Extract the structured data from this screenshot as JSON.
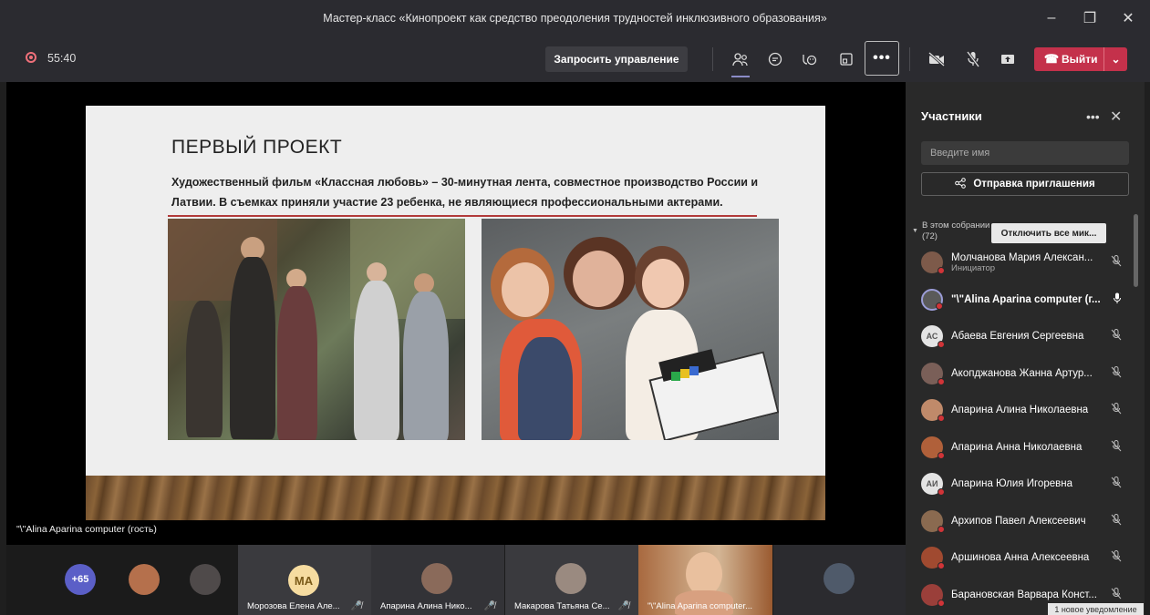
{
  "window": {
    "title": "Мастер-класс «Кинопроект как средство преодоления трудностей инклюзивного образования»",
    "controls": {
      "minimize": "–",
      "maximize": "❐",
      "close": "✕"
    }
  },
  "toolbar": {
    "timer": "55:40",
    "request_control_label": "Запросить управление",
    "more_label": "•••",
    "leave_label": "Выйти",
    "icons": [
      "participants-icon",
      "chat-icon",
      "reactions-icon",
      "rooms-icon",
      "camera-off-icon",
      "mic-off-icon",
      "share-icon"
    ]
  },
  "slide": {
    "title": "ПЕРВЫЙ ПРОЕКТ",
    "text": "Художественный фильм «Классная любовь» – 30-минутная лента, совместное производство России и Латвии. В съемках приняли участие 23 ребенка, не являющиеся профессиональными актерами."
  },
  "stage": {
    "presenter_label": "\"\\\"Alina Aparina computer (гость)"
  },
  "panel": {
    "title": "Участники",
    "more": "•••",
    "close": "✕",
    "search_placeholder": "Введите имя",
    "invite_label": "Отправка приглашения",
    "group_label_line1": "В этом собрании",
    "group_label_line2": "(72)",
    "mute_all_label": "Отключить все мик...",
    "participants": [
      {
        "name": "Молчанова Мария Алексан...",
        "role": "Инициатор",
        "initials": "",
        "color": "#7d5a4a",
        "mic": "mic-off"
      },
      {
        "name": "\"\\\"Alina Aparina computer (г...",
        "role": "",
        "initials": "",
        "color": "#5a5a5a",
        "mic": "mic-on"
      },
      {
        "name": "Абаева Евгения Сергеевна",
        "role": "",
        "initials": "АС",
        "color": "#e4e4e4",
        "mic": "mic-off"
      },
      {
        "name": "Акопджанова Жанна Артур...",
        "role": "",
        "initials": "",
        "color": "#7a5f58",
        "mic": "mic-off"
      },
      {
        "name": "Апарина Алина Николаевна",
        "role": "",
        "initials": "",
        "color": "#c08a6a",
        "mic": "mic-off"
      },
      {
        "name": "Апарина Анна Николаевна",
        "role": "",
        "initials": "",
        "color": "#b0603a",
        "mic": "mic-off"
      },
      {
        "name": "Апарина Юлия Игоревна",
        "role": "",
        "initials": "АИ",
        "color": "#e4e4e4",
        "mic": "mic-off"
      },
      {
        "name": "Архипов Павел Алексеевич",
        "role": "",
        "initials": "",
        "color": "#8a6a50",
        "mic": "mic-off"
      },
      {
        "name": "Аршинова Анна Алексеевна",
        "role": "",
        "initials": "",
        "color": "#a04a30",
        "mic": "mic-off"
      },
      {
        "name": "Барановская Варвара Конст...",
        "role": "",
        "initials": "",
        "color": "#9a3f3a",
        "mic": "mic-off"
      }
    ]
  },
  "strip": {
    "overflow_count": "+65",
    "tiles": [
      {
        "name": "Морозова Елена Але...",
        "initials": "МА"
      },
      {
        "name": "Апарина Алина Нико...",
        "initials": ""
      },
      {
        "name": "Макарова Татьяна Се...",
        "initials": ""
      },
      {
        "name": "\"\\\"Alina Aparina computer...",
        "initials": ""
      }
    ]
  },
  "notification": "1 новое уведомление",
  "colors": {
    "accent": "#8b8cc7",
    "leave": "#c4314b",
    "record": "#f0707a",
    "muted_dot": "#d13438"
  }
}
